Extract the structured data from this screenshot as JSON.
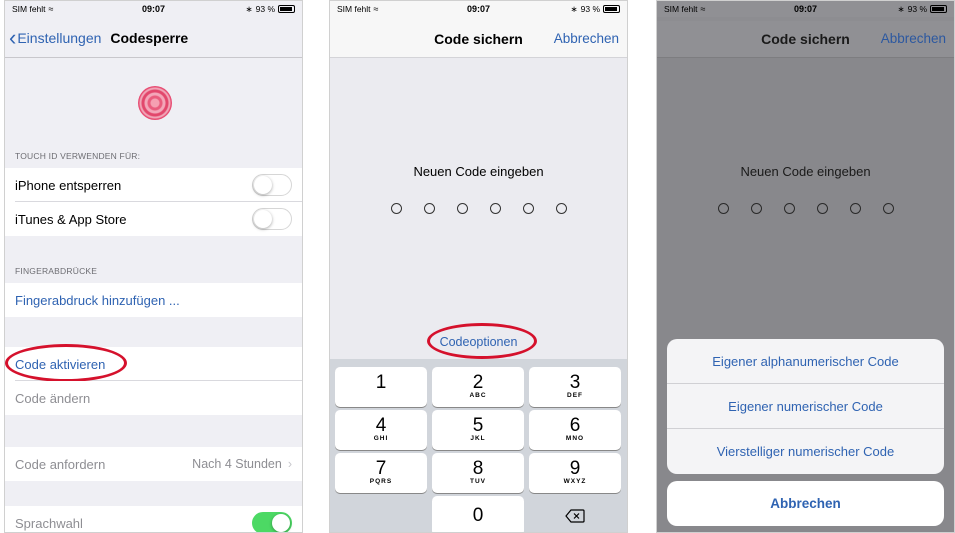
{
  "status": {
    "carrier": "SIM fehlt",
    "time": "09:07",
    "battery": "93 %"
  },
  "phone1": {
    "back_label": "Einstellungen",
    "title": "Codesperre",
    "section_touchid": "TOUCH ID VERWENDEN FÜR:",
    "row_unlock": "iPhone entsperren",
    "row_itunes": "iTunes & App Store",
    "section_fingerprints": "FINGERABDRÜCKE",
    "row_add_fingerprint": "Fingerabdruck hinzufügen ...",
    "row_activate_code": "Code aktivieren",
    "row_change_code": "Code ändern",
    "row_require_code": "Code anfordern",
    "row_require_value": "Nach 4 Stunden",
    "row_voice": "Sprachwahl",
    "toggle_unlock_on": false,
    "toggle_itunes_on": false,
    "toggle_voice_on": true
  },
  "phone2": {
    "title": "Code sichern",
    "cancel": "Abbrechen",
    "prompt": "Neuen Code eingeben",
    "code_options": "Codeoptionen",
    "keys": [
      {
        "digit": "1",
        "letters": ""
      },
      {
        "digit": "2",
        "letters": "ABC"
      },
      {
        "digit": "3",
        "letters": "DEF"
      },
      {
        "digit": "4",
        "letters": "GHI"
      },
      {
        "digit": "5",
        "letters": "JKL"
      },
      {
        "digit": "6",
        "letters": "MNO"
      },
      {
        "digit": "7",
        "letters": "PQRS"
      },
      {
        "digit": "8",
        "letters": "TUV"
      },
      {
        "digit": "9",
        "letters": "WXYZ"
      },
      {
        "digit": "0",
        "letters": ""
      }
    ],
    "delete_icon": "backspace-icon"
  },
  "phone3": {
    "title": "Code sichern",
    "cancel": "Abbrechen",
    "prompt": "Neuen Code eingeben",
    "options": [
      "Eigener alphanumerischer Code",
      "Eigener numerischer Code",
      "Vierstelliger numerischer Code"
    ],
    "sheet_cancel": "Abbrechen"
  },
  "colors": {
    "ios_blue": "#2f63b2",
    "highlight_red": "#d5112c",
    "toggle_green": "#4cd964"
  }
}
